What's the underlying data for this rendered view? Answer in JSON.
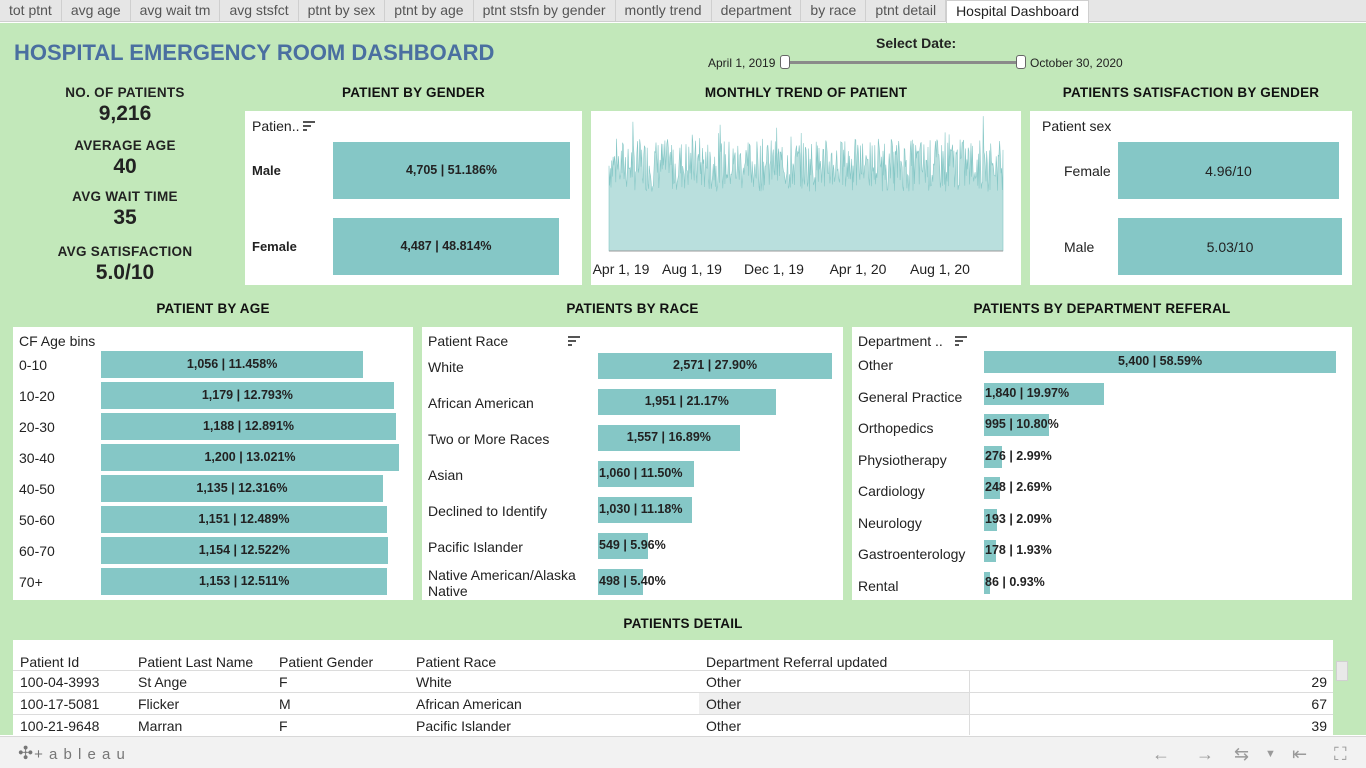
{
  "tabs": [
    {
      "label": "tot ptnt",
      "active": false
    },
    {
      "label": "avg age",
      "active": false
    },
    {
      "label": "avg wait tm",
      "active": false
    },
    {
      "label": "avg stsfct",
      "active": false
    },
    {
      "label": "ptnt by sex",
      "active": false
    },
    {
      "label": "ptnt by age",
      "active": false
    },
    {
      "label": "ptnt stsfn by gender",
      "active": false
    },
    {
      "label": "montly trend",
      "active": false
    },
    {
      "label": "department",
      "active": false
    },
    {
      "label": "by race",
      "active": false
    },
    {
      "label": "ptnt detail",
      "active": false
    },
    {
      "label": "Hospital Dashboard",
      "active": true
    }
  ],
  "dashboard": {
    "title": "HOSPITAL EMERGENCY ROOM DASHBOARD",
    "date_filter": {
      "label": "Select Date:",
      "start": "April 1, 2019",
      "end": "October 30, 2020"
    },
    "kpis": [
      {
        "label": "NO. OF PATIENTS",
        "value": "9,216"
      },
      {
        "label": "AVERAGE AGE",
        "value": "40"
      },
      {
        "label": "AVG WAIT TIME",
        "value": "35"
      },
      {
        "label": "AVG SATISFACTION",
        "value": "5.0/10"
      }
    ],
    "sections": {
      "gender": "PATIENT BY GENDER",
      "trend": "MONTHLY TREND OF PATIENT",
      "satisfaction": "PATIENTS SATISFACTION BY GENDER",
      "age": "PATIENT BY AGE",
      "race": "PATIENTS BY RACE",
      "department": "PATIENTS BY DEPARTMENT REFERAL",
      "detail": "PATIENTS DETAIL"
    },
    "colors": {
      "bar": "#85c7c6",
      "background": "#c2e8ba",
      "title": "#4a6fa0"
    }
  },
  "chart_data": [
    {
      "type": "bar",
      "header": "Patien..",
      "categories": [
        "Male",
        "Female"
      ],
      "values": [
        4705,
        4487
      ],
      "labels": [
        "4,705 | 51.186%",
        "4,487 | 48.814%"
      ]
    },
    {
      "type": "area",
      "x_ticks": [
        "Apr 1, 19",
        "Aug 1, 19",
        "Dec 1, 19",
        "Apr 1, 20",
        "Aug 1, 20"
      ],
      "x_range": [
        "2019-04-01",
        "2020-10-30"
      ]
    },
    {
      "type": "bar",
      "header": "Patient sex",
      "categories": [
        "Female",
        "Male"
      ],
      "values": [
        4.96,
        5.03
      ],
      "labels": [
        "4.96/10",
        "5.03/10"
      ]
    },
    {
      "type": "bar",
      "header": "CF Age bins",
      "categories": [
        "0-10",
        "10-20",
        "20-30",
        "30-40",
        "40-50",
        "50-60",
        "60-70",
        "70+"
      ],
      "values": [
        1056,
        1179,
        1188,
        1200,
        1135,
        1151,
        1154,
        1153
      ],
      "labels": [
        "1,056 | 11.458%",
        "1,179 | 12.793%",
        "1,188 | 12.891%",
        "1,200 | 13.021%",
        "1,135 | 12.316%",
        "1,151 | 12.489%",
        "1,154 | 12.522%",
        "1,153 | 12.511%"
      ]
    },
    {
      "type": "bar",
      "header": "Patient Race",
      "categories": [
        "White",
        "African American",
        "Two or More Races",
        "Asian",
        "Declined to Identify",
        "Pacific Islander",
        "Native American/Alaska Native"
      ],
      "values": [
        2571,
        1951,
        1557,
        1060,
        1030,
        549,
        498
      ],
      "labels": [
        "2,571 | 27.90%",
        "1,951 | 21.17%",
        "1,557 | 16.89%",
        "1,060 | 11.50%",
        "1,030 | 11.18%",
        "549 | 5.96%",
        "498 | 5.40%"
      ]
    },
    {
      "type": "bar",
      "header": "Department ..",
      "categories": [
        "Other",
        "General Practice",
        "Orthopedics",
        "Physiotherapy",
        "Cardiology",
        "Neurology",
        "Gastroenterology",
        "Rental"
      ],
      "values": [
        5400,
        1840,
        995,
        276,
        248,
        193,
        178,
        86
      ],
      "labels": [
        "5,400 | 58.59%",
        "1,840 | 19.97%",
        "995 | 10.80%",
        "276 | 2.99%",
        "248 | 2.69%",
        "193 | 2.09%",
        "178 | 1.93%",
        "86 | 0.93%"
      ]
    }
  ],
  "detail_table": {
    "columns": [
      "Patient Id",
      "Patient Last Name",
      "Patient Gender",
      "Patient Race",
      "Department Referral updated"
    ],
    "rows": [
      [
        "100-04-3993",
        "St Ange",
        "F",
        "White",
        "Other",
        "29"
      ],
      [
        "100-17-5081",
        "Flicker",
        "M",
        "African American",
        "Other",
        "67"
      ],
      [
        "100-21-9648",
        "Marran",
        "F",
        "Pacific Islander",
        "Other",
        "39"
      ]
    ]
  },
  "toolbar": {
    "brand": "+ a b l e a u",
    "icons": [
      "undo-icon",
      "redo-icon",
      "revert-icon",
      "reset-icon",
      "fullscreen-icon"
    ]
  }
}
